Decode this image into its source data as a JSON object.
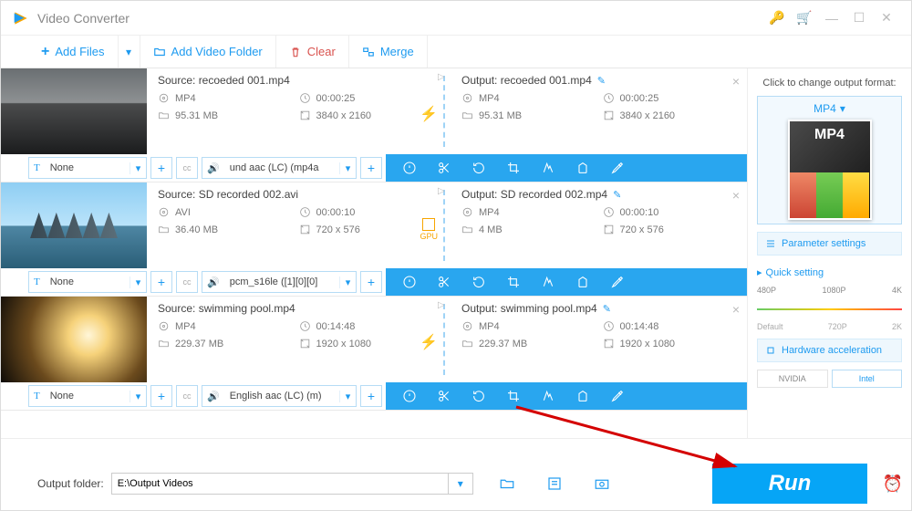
{
  "app": {
    "title": "Video Converter"
  },
  "toolbar": {
    "add_files": "Add Files",
    "add_folder": "Add Video Folder",
    "clear": "Clear",
    "merge": "Merge"
  },
  "items": [
    {
      "source_label": "Source: recoeded 001.mp4",
      "output_label": "Output: recoeded 001.mp4",
      "src": {
        "container": "MP4",
        "duration": "00:00:25",
        "size": "95.31 MB",
        "dims": "3840 x 2160"
      },
      "out": {
        "container": "MP4",
        "duration": "00:00:25",
        "size": "95.31 MB",
        "dims": "3840 x 2160"
      },
      "subs": "None",
      "audio": "und aac (LC) (mp4a",
      "decor": "bolt"
    },
    {
      "source_label": "Source: SD recorded 002.avi",
      "output_label": "Output: SD recorded 002.mp4",
      "src": {
        "container": "AVI",
        "duration": "00:00:10",
        "size": "36.40 MB",
        "dims": "720 x 576"
      },
      "out": {
        "container": "MP4",
        "duration": "00:00:10",
        "size": "4 MB",
        "dims": "720 x 576"
      },
      "subs": "None",
      "audio": "pcm_s16le ([1][0][0]",
      "decor": "gpu"
    },
    {
      "source_label": "Source: swimming pool.mp4",
      "output_label": "Output: swimming pool.mp4",
      "src": {
        "container": "MP4",
        "duration": "00:14:48",
        "size": "229.37 MB",
        "dims": "1920 x 1080"
      },
      "out": {
        "container": "MP4",
        "duration": "00:14:48",
        "size": "229.37 MB",
        "dims": "1920 x 1080"
      },
      "subs": "None",
      "audio": "English aac (LC) (m)",
      "decor": "bolt"
    }
  ],
  "side": {
    "hint": "Click to change output format:",
    "format": "MP4",
    "param_btn": "Parameter settings",
    "quick_title": "Quick setting",
    "scale_top": [
      "480P",
      "1080P",
      "4K"
    ],
    "scale_bot": [
      "Default",
      "720P",
      "2K"
    ],
    "hw_btn": "Hardware acceleration",
    "vendors": [
      "NVIDIA",
      "Intel"
    ]
  },
  "footer": {
    "label": "Output folder:",
    "path": "E:\\Output Videos",
    "run": "Run"
  }
}
